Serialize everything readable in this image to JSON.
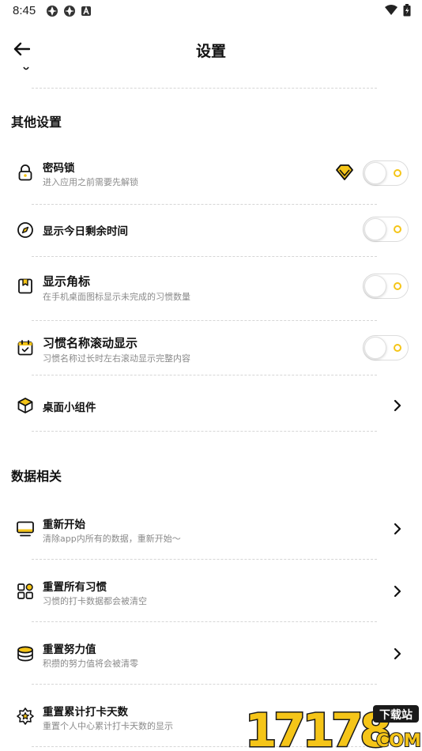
{
  "status_bar": {
    "time": "8:45",
    "left_icons": [
      "app-notification-icon",
      "app-notification-icon",
      "a-box-icon"
    ],
    "right_icons": [
      "wifi-icon",
      "battery-icon"
    ]
  },
  "header": {
    "title": "设置",
    "back_icon": "arrow-left-icon"
  },
  "colors": {
    "accent": "#f5c518",
    "text_primary": "#111111",
    "text_secondary": "#8a8a8a",
    "divider": "#d6d6d6"
  },
  "sections": {
    "other": {
      "title": "其他设置",
      "items": [
        {
          "title": "密码锁",
          "subtitle": "进入应用之前需要先解锁",
          "icon": "lock-icon",
          "control": "toggle",
          "toggle_on": false,
          "vip": true
        },
        {
          "title": "显示今日剩余时间",
          "subtitle": "",
          "icon": "compass-icon",
          "control": "toggle",
          "toggle_on": false
        },
        {
          "title": "显示角标",
          "subtitle": "在手机桌面图标显示未完成的习惯数量",
          "icon": "bookmark-icon",
          "control": "toggle",
          "toggle_on": false
        },
        {
          "title": "习惯名称滚动显示",
          "subtitle": "习惯名称过长时左右滚动显示完整内容",
          "icon": "calendar-check-icon",
          "control": "toggle",
          "toggle_on": false
        },
        {
          "title": "桌面小组件",
          "subtitle": "",
          "icon": "cube-icon",
          "control": "chevron"
        }
      ]
    },
    "data": {
      "title": "数据相关",
      "items": [
        {
          "title": "重新开始",
          "subtitle": "清除app内所有的数据，重新开始～",
          "icon": "monitor-icon",
          "control": "chevron"
        },
        {
          "title": "重置所有习惯",
          "subtitle": "习惯的打卡数据都会被清空",
          "icon": "grid-icon",
          "control": "chevron"
        },
        {
          "title": "重置努力值",
          "subtitle": "积攒的努力值将会被清零",
          "icon": "coins-icon",
          "control": "chevron"
        },
        {
          "title": "重置累计打卡天数",
          "subtitle": "重置个人中心累计打卡天数的显示",
          "icon": "star-badge-icon",
          "control": "chevron"
        }
      ]
    }
  },
  "watermark": {
    "number": "17178",
    "tag": "下载站",
    "domain": "COM"
  }
}
